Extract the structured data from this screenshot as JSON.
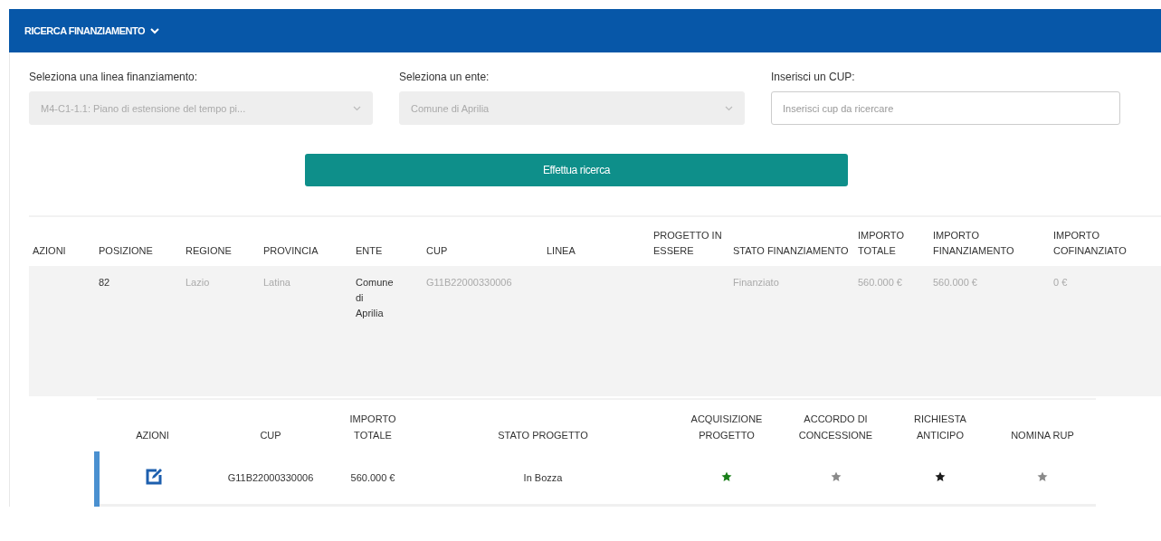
{
  "panel": {
    "title": "RICERCA FINANZIAMENTO",
    "expanded": true
  },
  "filters": [
    {
      "label": "Seleziona una linea finanziamento:",
      "kind": "select",
      "value": "M4-C1-1.1: Piano di estensione del tempo pi...",
      "disabled": true
    },
    {
      "label": "Seleziona un ente:",
      "kind": "select",
      "value": "Comune di Aprilia",
      "disabled": true
    },
    {
      "label": "Inserisci un CUP:",
      "kind": "input",
      "placeholder": "Inserisci cup da ricercare",
      "disabled": false
    }
  ],
  "search_button": "Effettua ricerca",
  "table": {
    "columns": [
      "AZIONI",
      "POSIZIONE",
      "REGIONE",
      "PROVINCIA",
      "ENTE",
      "CUP",
      "LINEA",
      "PROGETTO IN ESSERE",
      "STATO FINANZIAMENTO",
      "IMPORTO TOTALE",
      "IMPORTO FINANZIAMENTO",
      "IMPORTO COFINANZIATO"
    ],
    "rows": [
      {
        "cells": [
          "",
          "82",
          "Lazio",
          "Latina",
          "Comune di Aprilia",
          "G11B22000330006",
          "",
          "",
          "Finanziato",
          "560.000 €",
          "560.000 €",
          "0 €"
        ]
      }
    ]
  },
  "subtable": {
    "columns": [
      "AZIONI",
      "CUP",
      "IMPORTO TOTALE",
      "STATO PROGETTO",
      "ACQUISIZIONE PROGETTO",
      "ACCORDO DI CONCESSIONE",
      "RICHIESTA ANTICIPO",
      "NOMINA RUP"
    ],
    "rows": [
      {
        "cup": "G11B22000330006",
        "importo": "560.000 €",
        "stato": "In Bozza",
        "steps": [
          {
            "color": "#1a7f1a"
          },
          {
            "color": "#8a8a8a"
          },
          {
            "color": "#1c1c1c"
          },
          {
            "color": "#8a8a8a"
          }
        ]
      }
    ]
  }
}
